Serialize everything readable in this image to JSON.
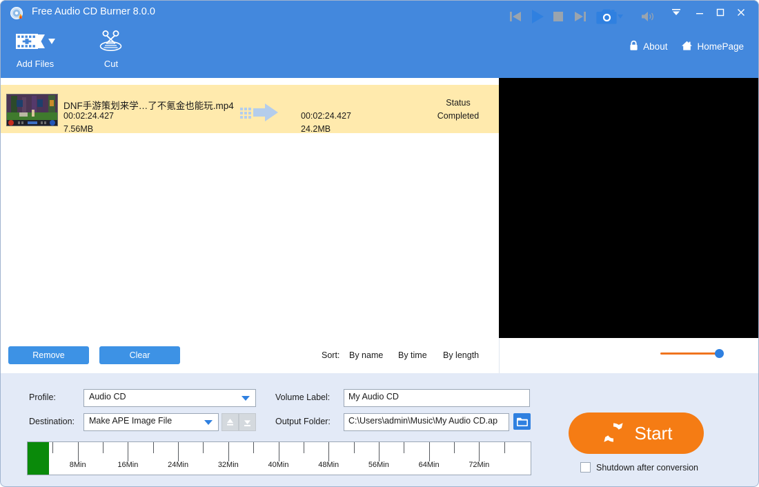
{
  "window": {
    "title": "Free Audio CD Burner 8.0.0",
    "app_icon": "cd-flame-icon",
    "controls": {
      "skin": "skin-chevron-icon",
      "minimize": "minimize-icon",
      "maximize": "maximize-icon",
      "close": "close-icon"
    },
    "accent_blue": "#4388dd",
    "accent_orange": "#f57c14"
  },
  "toolbar": {
    "add_files": {
      "label": "Add Files",
      "icon": "add-files-icon",
      "has_dropdown": true
    },
    "cut": {
      "label": "Cut",
      "icon": "scissors-icon"
    }
  },
  "corner_links": {
    "about": {
      "label": "About",
      "icon": "lock-icon"
    },
    "homepage": {
      "label": "HomePage",
      "icon": "home-icon"
    }
  },
  "file_list": {
    "rows": [
      {
        "thumbnail": "video-thumbnail",
        "name": "DNF手游策划来学…了不氪金也能玩.mp4",
        "duration": "00:02:24.427",
        "size": "7.56MB",
        "convert_icon": "convert-arrow-icon",
        "output_duration": "00:02:24.427",
        "output_size": "24.2MB",
        "status_header": "Status",
        "status_value": "Completed",
        "row_color": "#ffeaad"
      }
    ]
  },
  "list_actions": {
    "remove_label": "Remove",
    "clear_label": "Clear",
    "sort_label": "Sort:",
    "sort_options": [
      "By name",
      "By time",
      "By length"
    ]
  },
  "player": {
    "preview_background": "#000000",
    "controls": [
      {
        "name": "previous-button",
        "icon": "skip-previous-icon"
      },
      {
        "name": "play-button",
        "icon": "play-icon"
      },
      {
        "name": "stop-button",
        "icon": "stop-icon"
      },
      {
        "name": "next-button",
        "icon": "skip-next-icon"
      },
      {
        "name": "snapshot-button",
        "icon": "camera-icon"
      },
      {
        "name": "volume-button",
        "icon": "speaker-icon"
      }
    ],
    "volume_percent": 100,
    "volume_track_color": "#f0741e",
    "volume_knob_color": "#2f80e0"
  },
  "settings": {
    "profile": {
      "label": "Profile:",
      "value": "Audio CD"
    },
    "destination": {
      "label": "Destination:",
      "value": "Make APE Image File"
    },
    "volume_label": {
      "label": "Volume Label:",
      "value": "My Audio CD"
    },
    "output_folder": {
      "label": "Output Folder:",
      "value": "C:\\Users\\admin\\Music\\My Audio CD.ap"
    },
    "browse_icon": "folder-icon",
    "move_up_icon": "move-up-icon",
    "move_down_icon": "move-down-icon"
  },
  "capacity_bar": {
    "fill_percent": 4.2,
    "fill_color": "#0a8a0a",
    "tick_labels": [
      "8Min",
      "16Min",
      "24Min",
      "32Min",
      "40Min",
      "48Min",
      "56Min",
      "64Min",
      "72Min"
    ],
    "max_minutes": 80
  },
  "action": {
    "start_label": "Start",
    "start_icon": "refresh-circular-icon",
    "shutdown_label": "Shutdown after conversion",
    "shutdown_checked": false
  }
}
